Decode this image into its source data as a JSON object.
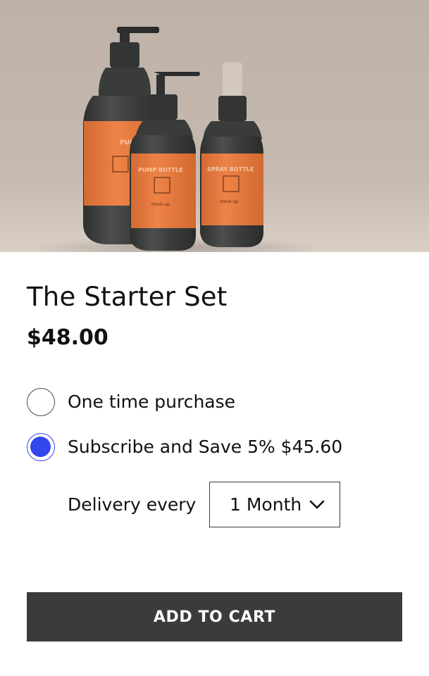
{
  "product": {
    "title": "The Starter Set",
    "price": "$48.00"
  },
  "purchase_options": {
    "one_time_label": "One time purchase",
    "subscribe_label": "Subscribe and Save 5% $45.60",
    "selected": "subscribe"
  },
  "delivery": {
    "label": "Delivery every",
    "selected_frequency": "1 Month"
  },
  "cart": {
    "add_label": "ADD TO CART"
  },
  "colors": {
    "radio_selected": "#3346ec",
    "button_background": "#3b3b3b",
    "bottle_label": "#e5793f",
    "bottle_body": "#3f4140"
  },
  "icons": {
    "select_arrow": "chevron-down-icon"
  }
}
